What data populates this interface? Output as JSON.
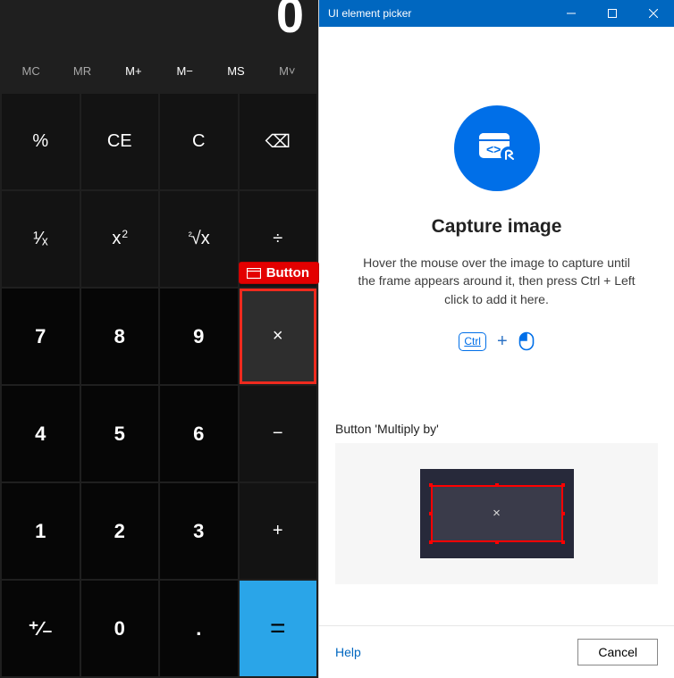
{
  "calc": {
    "display": "0",
    "memory": [
      "MC",
      "MR",
      "M+",
      "M−",
      "MS",
      "M˅"
    ],
    "memory_active": [
      false,
      false,
      true,
      true,
      true,
      false
    ],
    "keys": {
      "percent": "%",
      "ce": "CE",
      "c": "C",
      "backspace": "⌫",
      "reciprocal": "¹⁄ₓ",
      "square_base": "x",
      "square_exp": "2",
      "root_pre": "²",
      "root_sym": "√x",
      "divide": "÷",
      "seven": "7",
      "eight": "8",
      "nine": "9",
      "multiply": "×",
      "four": "4",
      "five": "5",
      "six": "6",
      "minus": "−",
      "one": "1",
      "two": "2",
      "three": "3",
      "plus": "+",
      "negate": "⁺∕₋",
      "zero": "0",
      "decimal": ".",
      "equals": "="
    },
    "badge_label": "Button"
  },
  "picker": {
    "title": "UI element picker",
    "hero_title": "Capture image",
    "hero_desc": "Hover the mouse over the image to capture until the frame appears around it, then press Ctrl + Left click to add it here.",
    "kbd": "Ctrl",
    "captured_label": "Button 'Multiply by'",
    "preview_glyph": "×",
    "help": "Help",
    "cancel": "Cancel"
  }
}
